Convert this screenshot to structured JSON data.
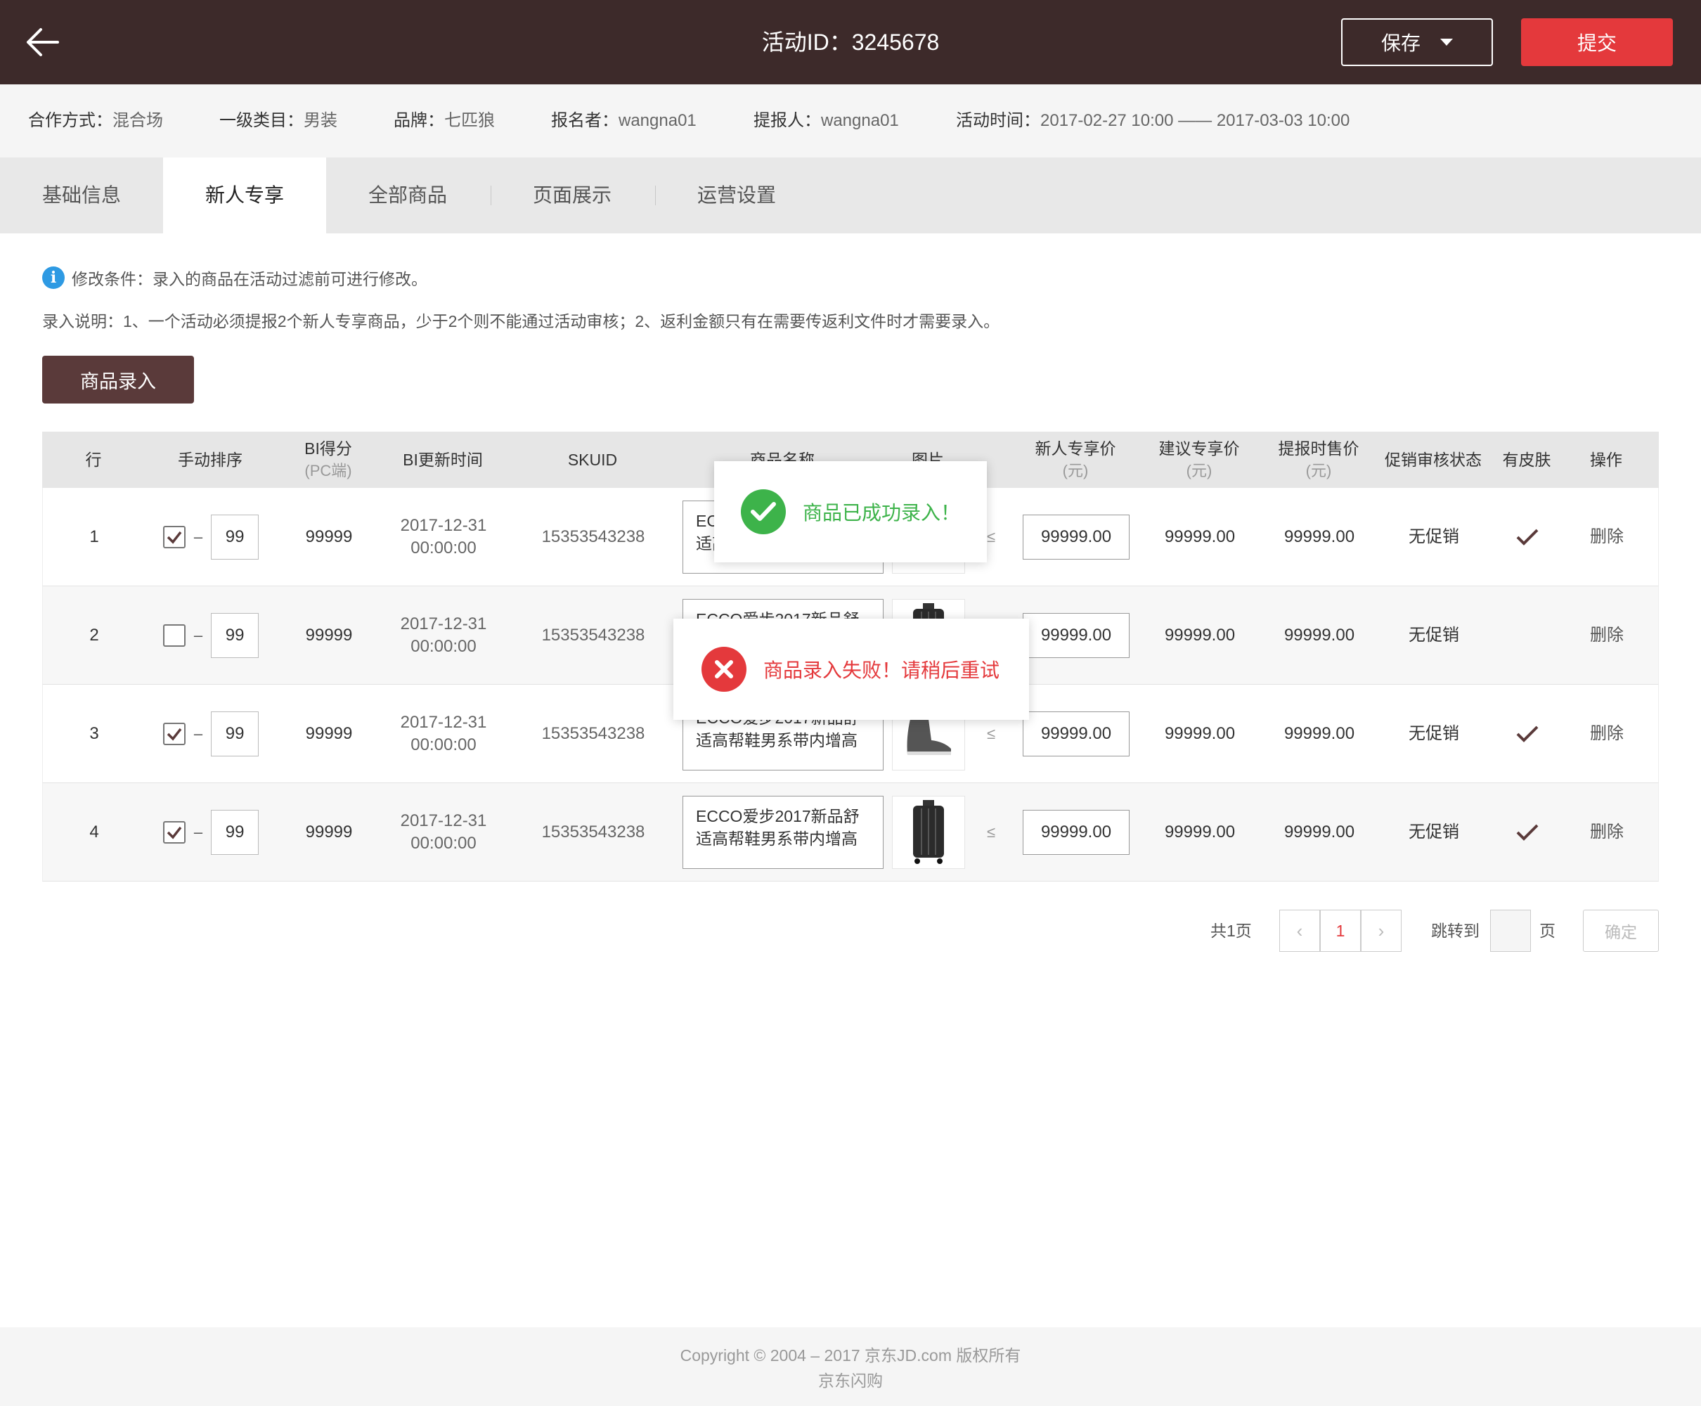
{
  "header": {
    "title": "活动ID：3245678",
    "save_label": "保存",
    "submit_label": "提交"
  },
  "info": [
    {
      "label": "合作方式：",
      "value": "混合场"
    },
    {
      "label": "一级类目：",
      "value": "男装"
    },
    {
      "label": "品牌：",
      "value": "七匹狼"
    },
    {
      "label": "报名者：",
      "value": "wangna01"
    },
    {
      "label": "提报人：",
      "value": "wangna01"
    },
    {
      "label": "活动时间：",
      "value": "2017-02-27 10:00 —— 2017-03-03 10:00"
    }
  ],
  "tabs": [
    {
      "label": "基础信息"
    },
    {
      "label": "新人专享"
    },
    {
      "label": "全部商品"
    },
    {
      "label": "页面展示"
    },
    {
      "label": "运营设置"
    }
  ],
  "active_tab": "新人专享",
  "notices": {
    "condition": "修改条件：录入的商品在活动过滤前可进行修改。",
    "instruction": "录入说明：1、一个活动必须提报2个新人专享商品，少于2个则不能通过活动审核；2、返利金额只有在需要传返利文件时才需要录入。"
  },
  "add_button_label": "商品录入",
  "table": {
    "headers": [
      {
        "label": "行",
        "sub": ""
      },
      {
        "label": "手动排序",
        "sub": ""
      },
      {
        "label": "BI得分",
        "sub": "(PC端)"
      },
      {
        "label": "BI更新时间",
        "sub": ""
      },
      {
        "label": "SKUID",
        "sub": ""
      },
      {
        "label": "商品名称",
        "sub": ""
      },
      {
        "label": "图片",
        "sub": ""
      },
      {
        "label": "新人专享价",
        "sub": "(元)"
      },
      {
        "label": "建议专享价",
        "sub": "(元)"
      },
      {
        "label": "提报时售价",
        "sub": "(元)"
      },
      {
        "label": "促销审核状态",
        "sub": ""
      },
      {
        "label": "有皮肤",
        "sub": ""
      },
      {
        "label": "操作",
        "sub": ""
      }
    ],
    "rows": [
      {
        "row": "1",
        "checked": true,
        "sort": "99",
        "bi": "99999",
        "date": "2017-12-31",
        "time": "00:00:00",
        "skuid": "15353543238",
        "name": "ECCO爱步2017新品舒适高帮鞋男系带内增高",
        "image": "shoe-image",
        "le": "≤",
        "price": "99999.00",
        "suggest": "99999.00",
        "report": "99999.00",
        "status": "无促销",
        "skin": true,
        "action": "删除"
      },
      {
        "row": "2",
        "checked": false,
        "sort": "99",
        "bi": "99999",
        "date": "2017-12-31",
        "time": "00:00:00",
        "skuid": "15353543238",
        "name": "ECCO爱步2017新品舒适高帮鞋男系带内增高",
        "image": "suitcase-image",
        "le": "≤",
        "price": "99999.00",
        "suggest": "99999.00",
        "report": "99999.00",
        "status": "无促销",
        "skin": false,
        "action": "删除"
      },
      {
        "row": "3",
        "checked": true,
        "sort": "99",
        "bi": "99999",
        "date": "2017-12-31",
        "time": "00:00:00",
        "skuid": "15353543238",
        "name": "ECCO爱步2017新品舒适高帮鞋男系带内增高",
        "image": "shoe-image",
        "le": "≤",
        "price": "99999.00",
        "suggest": "99999.00",
        "report": "99999.00",
        "status": "无促销",
        "skin": true,
        "action": "删除"
      },
      {
        "row": "4",
        "checked": true,
        "sort": "99",
        "bi": "99999",
        "date": "2017-12-31",
        "time": "00:00:00",
        "skuid": "15353543238",
        "name": "ECCO爱步2017新品舒适高帮鞋男系带内增高",
        "image": "suitcase-image",
        "le": "≤",
        "price": "99999.00",
        "suggest": "99999.00",
        "report": "99999.00",
        "status": "无促销",
        "skin": true,
        "action": "删除"
      }
    ]
  },
  "toasts": {
    "success": "商品已成功录入！",
    "error": "商品录入失败！请稍后重试"
  },
  "pagination": {
    "total": "共1页",
    "current": "1",
    "jump_label": "跳转到",
    "page_unit": "页",
    "confirm": "确定"
  },
  "footer": {
    "copyright": "Copyright © 2004 – 2017  京东JD.com 版权所有",
    "brand": "京东闪购"
  },
  "colors": {
    "header_bg": "#3d2a2a",
    "accent_red": "#e4393c",
    "brown_button": "#5a3a3a",
    "success_green": "#3db34a",
    "info_blue": "#2e9ae3"
  }
}
